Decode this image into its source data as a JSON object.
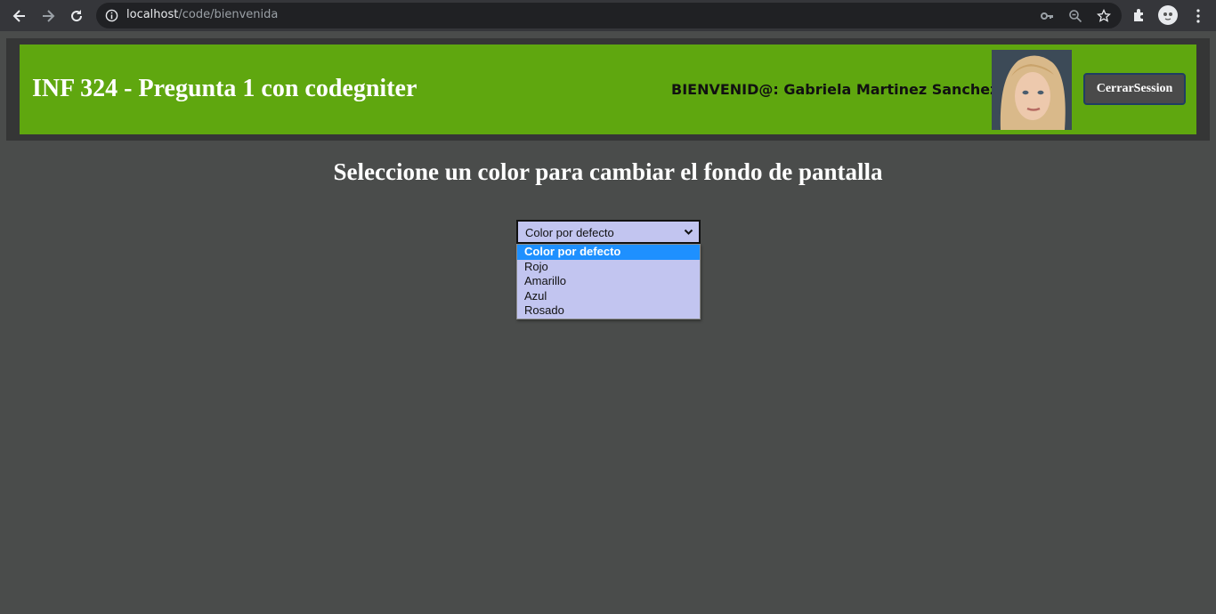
{
  "browser": {
    "url_host": "localhost",
    "url_path": "/code/bienvenida",
    "icons": [
      "back-icon",
      "forward-icon",
      "reload-icon",
      "info-icon",
      "key-icon",
      "zoom-icon",
      "star-icon",
      "puzzle-icon",
      "profile-icon",
      "menu-icon"
    ]
  },
  "header": {
    "title": "INF 324 - Pregunta 1 con codegniter",
    "welcome": "BIENVENID@: Gabriela Martinez Sanchez",
    "logout_label": "CerrarSession",
    "bg_color": "#5fa70f"
  },
  "main": {
    "heading": "Seleccione un color para cambiar el fondo de pantalla",
    "select": {
      "selected": "Color por defecto",
      "options": [
        "Color por defecto",
        "Rojo",
        "Amarillo",
        "Azul",
        "Rosado"
      ]
    },
    "bg_color": "#4a4c4b"
  }
}
